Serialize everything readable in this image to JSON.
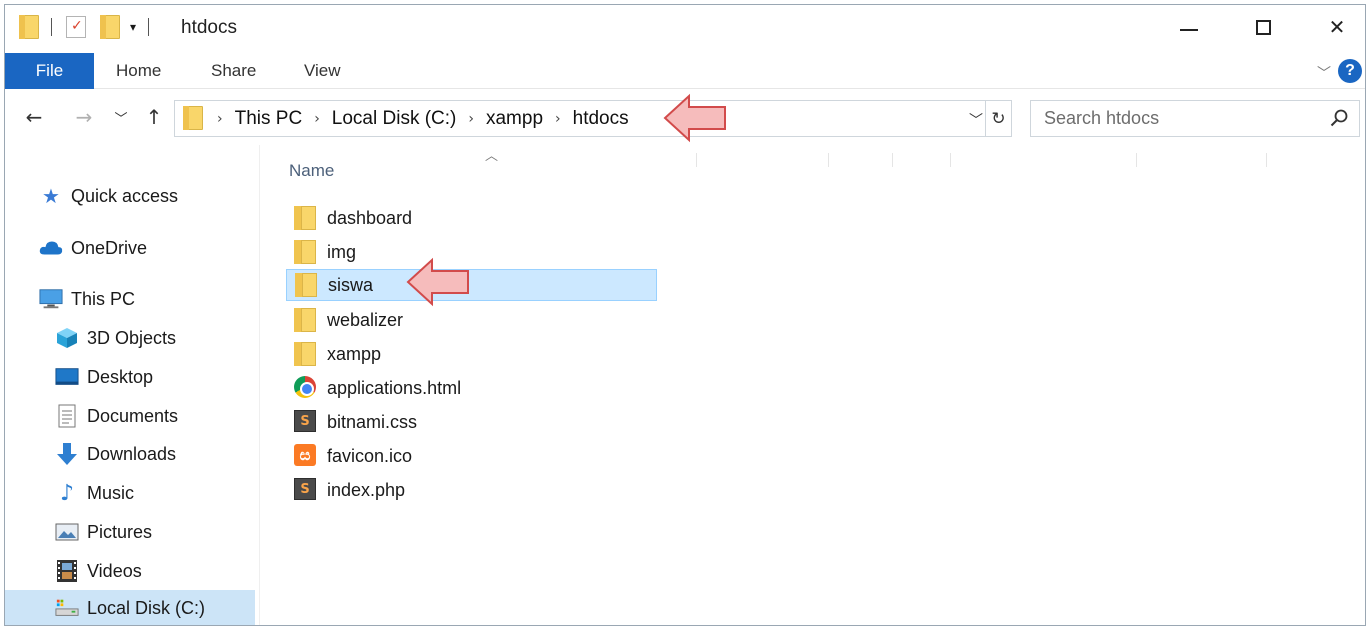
{
  "window": {
    "title": "htdocs"
  },
  "ribbon": {
    "tabs": [
      "File",
      "Home",
      "Share",
      "View"
    ]
  },
  "navigation": {
    "breadcrumb": [
      "This PC",
      "Local Disk (C:)",
      "xampp",
      "htdocs"
    ]
  },
  "search": {
    "placeholder": "Search htdocs"
  },
  "sidebar": {
    "items": [
      {
        "label": "Quick access",
        "icon": "star-icon"
      },
      {
        "label": "OneDrive",
        "icon": "cloud-icon"
      },
      {
        "label": "This PC",
        "icon": "computer-icon"
      },
      {
        "label": "3D Objects",
        "icon": "cube-icon"
      },
      {
        "label": "Desktop",
        "icon": "desktop-icon"
      },
      {
        "label": "Documents",
        "icon": "documents-icon"
      },
      {
        "label": "Downloads",
        "icon": "download-arrow-icon"
      },
      {
        "label": "Music",
        "icon": "music-note-icon"
      },
      {
        "label": "Pictures",
        "icon": "pictures-icon"
      },
      {
        "label": "Videos",
        "icon": "film-icon"
      },
      {
        "label": "Local Disk (C:)",
        "icon": "drive-icon"
      }
    ],
    "selected": "Local Disk (C:)"
  },
  "file_list": {
    "column_header": "Name",
    "items": [
      {
        "name": "dashboard",
        "type": "folder"
      },
      {
        "name": "img",
        "type": "folder"
      },
      {
        "name": "siswa",
        "type": "folder"
      },
      {
        "name": "webalizer",
        "type": "folder"
      },
      {
        "name": "xampp",
        "type": "folder"
      },
      {
        "name": "applications.html",
        "type": "chrome-html"
      },
      {
        "name": "bitnami.css",
        "type": "sublime-file"
      },
      {
        "name": "favicon.ico",
        "type": "xampp-icon"
      },
      {
        "name": "index.php",
        "type": "sublime-file"
      }
    ],
    "selected": "siswa"
  },
  "colors": {
    "accent": "#1a66c2",
    "selection": "#cce8ff",
    "annotation_arrow": "#f4b4b4"
  }
}
